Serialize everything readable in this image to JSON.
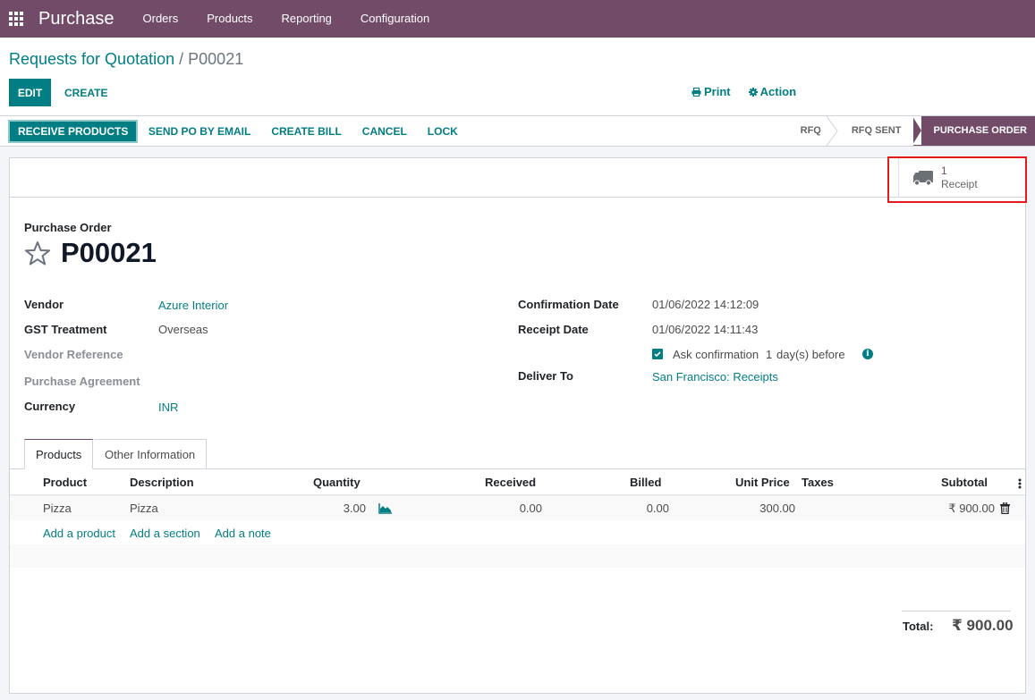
{
  "navbar": {
    "app_name": "Purchase",
    "menu": [
      "Orders",
      "Products",
      "Reporting",
      "Configuration"
    ]
  },
  "breadcrumb": {
    "parent": "Requests for Quotation",
    "separator": "/",
    "current": "P00021"
  },
  "control_panel": {
    "edit_label": "EDIT",
    "create_label": "CREATE",
    "print_label": "Print",
    "action_label": "Action"
  },
  "statusbar": {
    "buttons": [
      "RECEIVE PRODUCTS",
      "SEND PO BY EMAIL",
      "CREATE BILL",
      "CANCEL",
      "LOCK"
    ],
    "stages": [
      {
        "label": "RFQ",
        "active": false
      },
      {
        "label": "RFQ SENT",
        "active": false
      },
      {
        "label": "PURCHASE ORDER",
        "active": true
      }
    ]
  },
  "smart_button": {
    "icon": "truck-icon",
    "count": "1",
    "label": "Receipt"
  },
  "record": {
    "type_label": "Purchase Order",
    "name": "P00021",
    "favorite": false
  },
  "fields_left": [
    {
      "label": "Vendor",
      "value": "Azure Interior",
      "link": true,
      "muted": false
    },
    {
      "label": "GST Treatment",
      "value": "Overseas",
      "link": false,
      "muted": false
    },
    {
      "label": "Vendor Reference",
      "value": "",
      "link": false,
      "muted": true
    },
    {
      "label": "Purchase Agreement",
      "value": "",
      "link": false,
      "muted": true
    },
    {
      "label": "Currency",
      "value": "INR",
      "link": true,
      "muted": false
    }
  ],
  "fields_right": [
    {
      "label": "Confirmation Date",
      "value": "01/06/2022 14:12:09"
    },
    {
      "label": "Receipt Date",
      "value": "01/06/2022 14:11:43"
    },
    {
      "label": "Deliver To",
      "value": "San Francisco: Receipts"
    }
  ],
  "ask_confirmation": {
    "checked": true,
    "text_before": "Ask confirmation",
    "days": "1",
    "text_after": "day(s) before"
  },
  "tabs": [
    "Products",
    "Other Information"
  ],
  "order_lines": {
    "columns": [
      "Product",
      "Description",
      "Quantity",
      "Received",
      "Billed",
      "Unit Price",
      "Taxes",
      "Subtotal"
    ],
    "rows": [
      {
        "product": "Pizza",
        "description": "Pizza",
        "quantity": "3.00",
        "received": "0.00",
        "billed": "0.00",
        "unit_price": "300.00",
        "taxes": "",
        "subtotal": "₹ 900.00"
      }
    ],
    "add_links": [
      "Add a product",
      "Add a section",
      "Add a note"
    ]
  },
  "totals": {
    "label": "Total:",
    "value": "₹ 900.00"
  },
  "colors": {
    "brand": "#714b67",
    "accent": "#017e84",
    "highlight": "#e41b1b"
  }
}
